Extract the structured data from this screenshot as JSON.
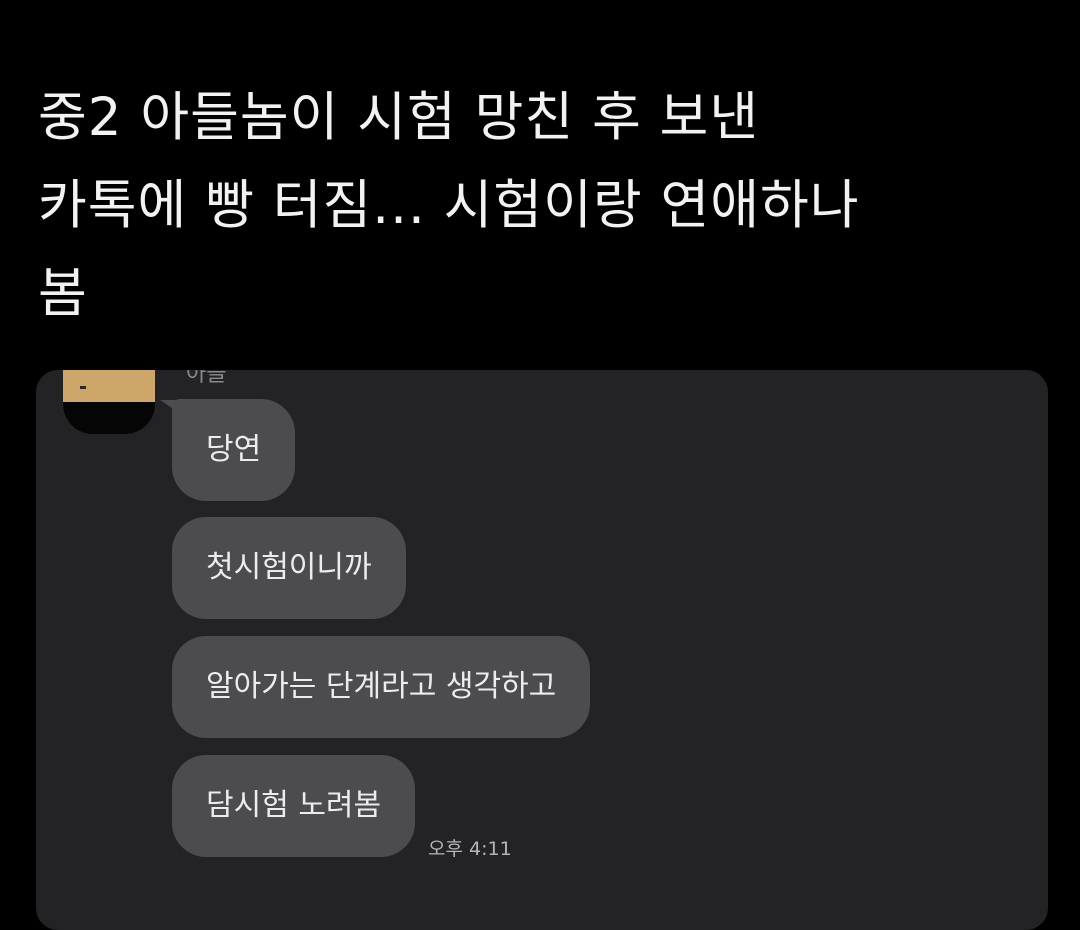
{
  "headline": {
    "line1": "중2 아들놈이 시험 망친 후 보낸",
    "line2": "카톡에 빵 터짐... 시험이랑 연애하나",
    "line3": "봄"
  },
  "chat": {
    "sender_name": "아들",
    "messages": [
      "당연",
      "첫시험이니까",
      "알아가는 단계라고 생각하고",
      "담시험 노려봄"
    ],
    "time": "오후 4:11"
  },
  "colors": {
    "background": "#000000",
    "panel": "#232325",
    "bubble": "#4c4c4f",
    "avatar_accent": "#cda66a"
  }
}
